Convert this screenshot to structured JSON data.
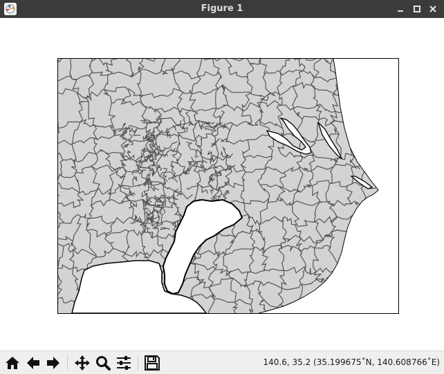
{
  "window": {
    "title": "Figure 1",
    "icon": "matplotlib-figure-icon",
    "controls": [
      "minimize-icon",
      "maximize-icon",
      "close-icon"
    ]
  },
  "map": {
    "description_type": "administrative-boundary-map",
    "land_color": "#d3d3d3",
    "boundary_color": "#555555",
    "coastline_color": "#000000",
    "water_color": "#ffffff"
  },
  "toolbar": {
    "buttons": [
      {
        "name": "home",
        "icon": "home-icon"
      },
      {
        "name": "back",
        "icon": "arrow-left-icon"
      },
      {
        "name": "forward",
        "icon": "arrow-right-icon"
      },
      {
        "name": "pan",
        "icon": "move-icon"
      },
      {
        "name": "zoom",
        "icon": "magnifier-icon"
      },
      {
        "name": "configure-subplots",
        "icon": "sliders-icon"
      },
      {
        "name": "save",
        "icon": "floppy-disk-icon"
      }
    ],
    "coordinates": "140.6, 35.2 (35.199675˚N, 140.608766˚E)"
  }
}
